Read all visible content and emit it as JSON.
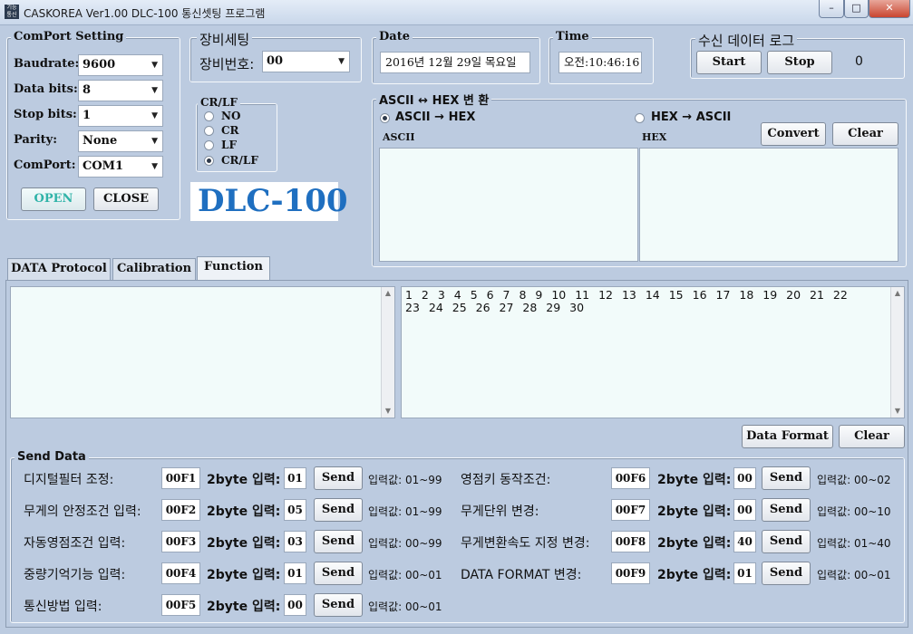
{
  "window": {
    "title": "CASKOREA Ver1.00 DLC-100 통신셋팅 프로그램",
    "icon_text": "기능 통신",
    "min_icon": "minimize-icon",
    "max_icon": "maximize-icon",
    "close_icon": "close-icon"
  },
  "comport": {
    "title": "ComPort Setting",
    "baudrate_label": "Baudrate:",
    "baudrate_value": "9600",
    "databits_label": "Data bits:",
    "databits_value": "8",
    "stopbits_label": "Stop bits:",
    "stopbits_value": "1",
    "parity_label": "Parity:",
    "parity_value": "None",
    "port_label": "ComPort:",
    "port_value": "COM1",
    "open_label": "OPEN",
    "close_label": "CLOSE"
  },
  "device": {
    "title": "장비세팅",
    "id_label": "장비번호:",
    "id_value": "00"
  },
  "crlf": {
    "title": "CR/LF",
    "options": [
      "NO",
      "CR",
      "LF",
      "CR/LF"
    ],
    "selected": "CR/LF"
  },
  "logo": {
    "text": "DLC-100",
    "color": "#1f6fc0"
  },
  "date": {
    "title": "Date",
    "value": "2016년 12월 29일 목요일"
  },
  "time": {
    "title": "Time",
    "value": "오전:10:46:16"
  },
  "log": {
    "title": "수신 데이터 로그",
    "start_label": "Start",
    "stop_label": "Stop",
    "count": "0"
  },
  "convert": {
    "title": "ASCII ↔ HEX 변 환",
    "opt_ascii_hex": "ASCII → HEX",
    "opt_hex_ascii": "HEX → ASCII",
    "selected": "ASCII → HEX",
    "convert_label": "Convert",
    "clear_label": "Clear",
    "ascii_header": "ASCII",
    "hex_header": "HEX"
  },
  "tabs": [
    {
      "label": "DATA Protocol",
      "active": false
    },
    {
      "label": "Calibration",
      "active": false
    },
    {
      "label": "Function",
      "active": true
    }
  ],
  "output": {
    "numbers_line1": "1  2  3  4  5  6  7  8  9  10 11 12 13 14 15 16 17 18 19 20 21 22",
    "numbers_line2": "23 24 25 26 27 28 29 30",
    "data_format_label": "Data Format",
    "clear_label": "Clear"
  },
  "send": {
    "title": "Send Data",
    "two_byte_label": "2byte 입력:",
    "send_label": "Send",
    "left_rows": [
      {
        "label": "디지털필터 조정:",
        "code": "00F1",
        "value": "01",
        "range": "입력값: 01~99"
      },
      {
        "label": "무게의 안정조건 입력:",
        "code": "00F2",
        "value": "05",
        "range": "입력값: 01~99"
      },
      {
        "label": "자동영점조건 입력:",
        "code": "00F3",
        "value": "03",
        "range": "입력값: 00~99"
      },
      {
        "label": "중량기억기능 입력:",
        "code": "00F4",
        "value": "01",
        "range": "입력값: 00~01"
      },
      {
        "label": "통신방법 입력:",
        "code": "00F5",
        "value": "00",
        "range": "입력값: 00~01"
      }
    ],
    "right_rows": [
      {
        "label": "영점키 동작조건:",
        "code": "00F6",
        "value": "00",
        "range": "입력값: 00~02"
      },
      {
        "label": "무게단위 변경:",
        "code": "00F7",
        "value": "00",
        "range": "입력값: 00~10"
      },
      {
        "label": "무게변환속도 지정 변경:",
        "code": "00F8",
        "value": "40",
        "range": "입력값: 01~40"
      },
      {
        "label": "DATA FORMAT 변경:",
        "code": "00F9",
        "value": "01",
        "range": "입력값: 00~01"
      }
    ]
  }
}
